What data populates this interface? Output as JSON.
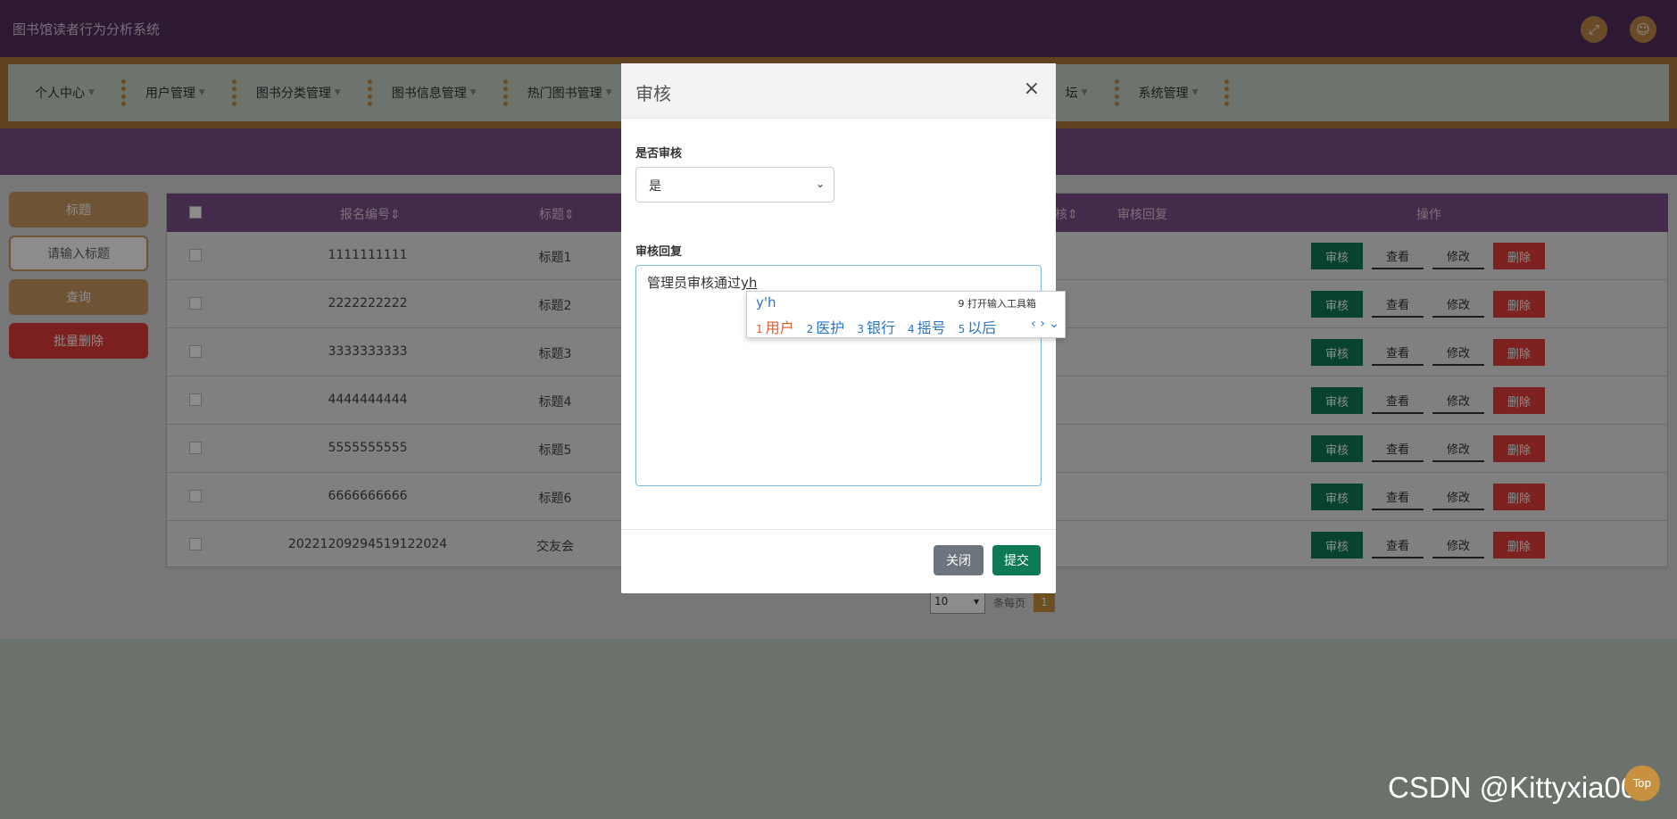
{
  "app": {
    "title": "图书馆读者行为分析系统"
  },
  "header": {
    "fullscreen_icon": "expand-icon",
    "user_icon": "user-icon"
  },
  "nav": {
    "items": [
      {
        "label": "个人中心"
      },
      {
        "label": "用户管理"
      },
      {
        "label": "图书分类管理"
      },
      {
        "label": "图书信息管理"
      },
      {
        "label": "热门图书管理"
      },
      {
        "label": "坛"
      },
      {
        "label": "系统管理"
      }
    ]
  },
  "sidebar": {
    "title_label": "标题",
    "search_placeholder": "请输入标题",
    "query_label": "查询",
    "batch_delete_label": "批量删除"
  },
  "table": {
    "headers": {
      "reg_no": "报名编号",
      "title": "标题",
      "partial": "核",
      "audit_reply": "审核回复",
      "actions": "操作"
    },
    "rows": [
      {
        "reg_no": "1111111111",
        "title": "标题1"
      },
      {
        "reg_no": "2222222222",
        "title": "标题2"
      },
      {
        "reg_no": "3333333333",
        "title": "标题3"
      },
      {
        "reg_no": "4444444444",
        "title": "标题4"
      },
      {
        "reg_no": "5555555555",
        "title": "标题5"
      },
      {
        "reg_no": "6666666666",
        "title": "标题6"
      },
      {
        "reg_no": "20221209294519122024",
        "title": "交友会"
      }
    ],
    "action_labels": {
      "audit": "审核",
      "view": "查看",
      "edit": "修改",
      "delete": "删除"
    }
  },
  "pagination": {
    "page_size": "10",
    "per_page_label": "条每页",
    "current_page": "1"
  },
  "modal": {
    "title": "审核",
    "close_glyph": "×",
    "audit_label": "是否审核",
    "audit_value": "是",
    "reply_label": "审核回复",
    "reply_text": "管理员审核通过",
    "reply_composing": "yh",
    "close_button": "关闭",
    "submit_button": "提交"
  },
  "ime": {
    "composition": "y'h",
    "toolbox": "9 打开输入工具箱",
    "candidates": [
      {
        "num": "1",
        "text": "用户"
      },
      {
        "num": "2",
        "text": "医护"
      },
      {
        "num": "3",
        "text": "银行"
      },
      {
        "num": "4",
        "text": "摇号"
      },
      {
        "num": "5",
        "text": "以后"
      }
    ]
  },
  "watermark": "CSDN @Kittyxia001",
  "top_button": "Top",
  "colors": {
    "header": "#522f5f",
    "accent": "#c89a62",
    "audit_btn": "#0d7a55",
    "delete_btn": "#e53c3c"
  }
}
